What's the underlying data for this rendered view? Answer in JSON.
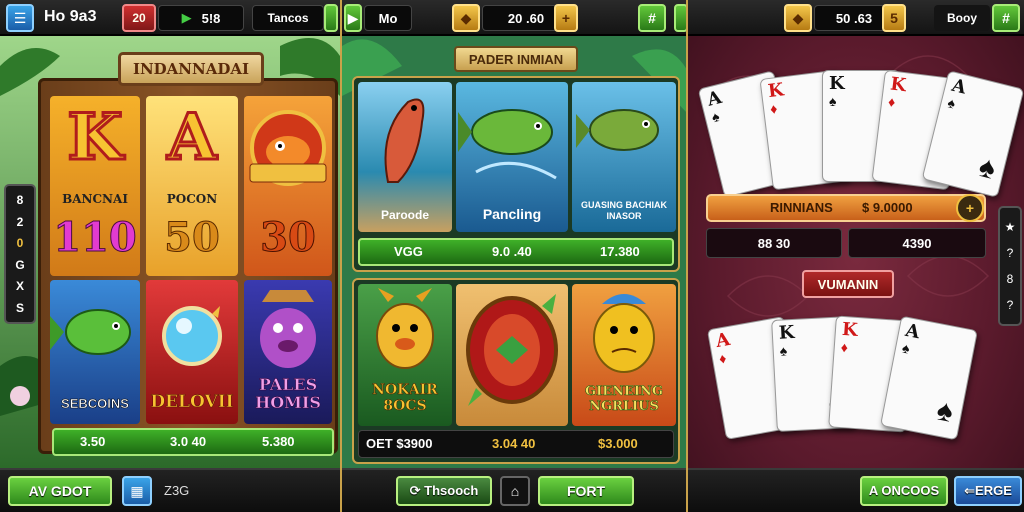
{
  "panel1": {
    "app_title": "Ho 9a3",
    "balance_badge": "20",
    "balance_value": "5!8",
    "tab_label": "Tancos",
    "banner": "INDANNADAI",
    "reels": [
      {
        "letter": "K",
        "name": "BANCNAI",
        "value": "110",
        "value_color": "#e23bd0"
      },
      {
        "letter": "A",
        "name": "POCON",
        "value": "50",
        "value_color": "#d98a1a"
      },
      {
        "letter": "",
        "name": "",
        "value": "30",
        "value_color": "#d84a14"
      }
    ],
    "fish_tile_label": "SEBCOINS",
    "orb_tile_label": "DELOVII",
    "monster_tile_label": "PALES HOMIS",
    "bet_values": [
      "3.50",
      "3.0 40",
      "5.380"
    ],
    "side_menu": [
      "8",
      "2",
      "0",
      "G",
      "X",
      "S"
    ],
    "play_button": "AV GDOT",
    "stake_label": "Z3G"
  },
  "panel2": {
    "play_label": "Mo",
    "coin_value": "20 .60",
    "title_banner": "PADER INMIAN",
    "fish_tiles": [
      {
        "label": "Paroode"
      },
      {
        "label": "Pancling"
      },
      {
        "label": "GUASING BACHIAK INASOR"
      }
    ],
    "row1_values": [
      "VGG",
      "9.0 .40",
      "17.380"
    ],
    "bottom_tiles": [
      {
        "label": "NOKAIR 8OCS"
      },
      {
        "label": ""
      },
      {
        "label": "GIENEING NGRLIUS"
      }
    ],
    "row2_values": [
      "OET $3900",
      "3.04 40",
      "$3.000"
    ],
    "bottom_buttons": [
      "Thsooch",
      "",
      "FORT"
    ]
  },
  "panel3": {
    "coin_value": "50 .63",
    "coin_badge": "5",
    "mode_label": "Booy",
    "jackpot_label": "RINNIANS",
    "jackpot_value": "$ 9.0000",
    "stats": [
      "88 30",
      "4390"
    ],
    "table_label": "VUMANIN",
    "side_icons": [
      "★",
      "?",
      "8",
      "?"
    ],
    "play_button": "A ONCOOS",
    "back_button": "ERGE",
    "top_cards": [
      {
        "rank": "A",
        "suit": "♠",
        "color": "blk"
      },
      {
        "rank": "K",
        "suit": "♦",
        "color": "red"
      },
      {
        "rank": "K",
        "suit": "♠",
        "color": "blk"
      },
      {
        "rank": "K",
        "suit": "♦",
        "color": "red"
      },
      {
        "rank": "A",
        "suit": "♠",
        "color": "blk"
      }
    ],
    "bottom_cards": [
      {
        "rank": "A",
        "suit": "♦",
        "color": "red"
      },
      {
        "rank": "K",
        "suit": "♠",
        "color": "blk"
      },
      {
        "rank": "K",
        "suit": "♦",
        "color": "red"
      },
      {
        "rank": "A",
        "suit": "♠",
        "color": "blk"
      }
    ]
  }
}
